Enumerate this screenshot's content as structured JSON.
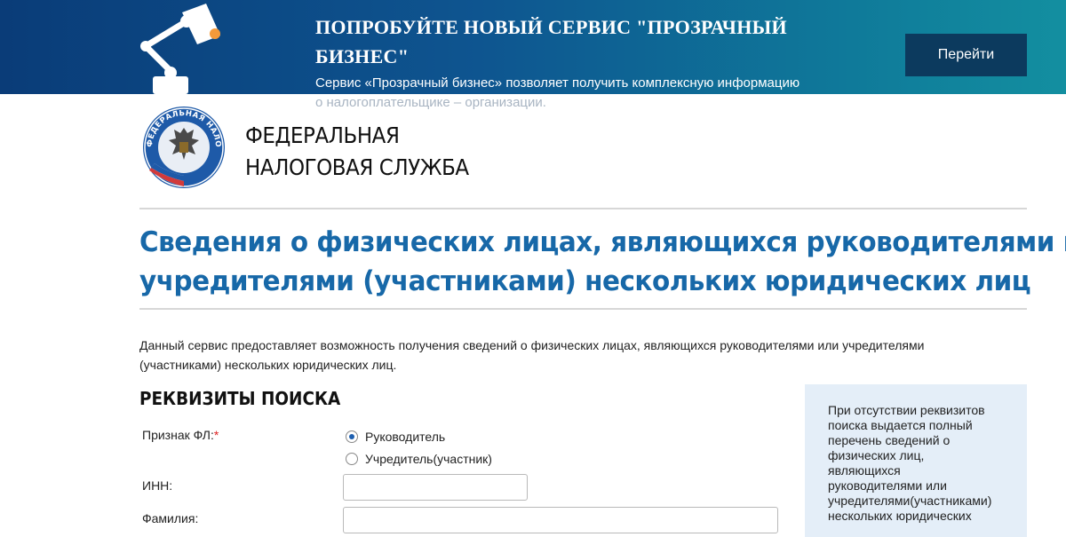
{
  "banner": {
    "title": "ПОПРОБУЙТЕ НОВЫЙ СЕРВИС \"ПРОЗРАЧНЫЙ БИЗНЕС\"",
    "description_line1": "Сервис «Прозрачный бизнес» позволяет получить комплексную информацию",
    "description_line2": "о налогоплательщике – организации.",
    "button_label": "Перейти",
    "icon": "desk-lamp-icon"
  },
  "header": {
    "emblem": "fns-emblem-icon",
    "emblem_text": "ФЕДЕРАЛЬНАЯ НАЛОГОВАЯ СЛУЖБА",
    "org_name_line1": "ФЕДЕРАЛЬНАЯ",
    "org_name_line2": "НАЛОГОВАЯ СЛУЖБА"
  },
  "page": {
    "title_line1": "Сведения о физических лицах, являющихся руководителями или",
    "title_line2": "учредителями (участниками) нескольких юридических лиц",
    "intro": "Данный сервис предоставляет возможность получения сведений о физических лицах, являющихся руководителями или учредителями (участниками) нескольких юридических лиц."
  },
  "form": {
    "heading": "РЕКВИЗИТЫ ПОИСКА",
    "sign_label": "Признак ФЛ:",
    "required_mark": "*",
    "radio_options": [
      {
        "label": "Руководитель",
        "checked": true
      },
      {
        "label": "Учредитель(участник)",
        "checked": false
      }
    ],
    "inn_label": "ИНН:",
    "inn_value": "",
    "surname_label": "Фамилия:",
    "surname_value": ""
  },
  "info_box": {
    "lines": [
      "При отсутствии реквизитов",
      "поиска выдается полный",
      "перечень сведений о",
      "физических лиц,",
      "являющихся",
      "руководителями или",
      "учредителями(участниками)",
      "нескольких юридических"
    ]
  },
  "colors": {
    "banner_dark": "#0a3c78",
    "banner_light": "#138fa0",
    "button_bg": "#0c3a5e",
    "title_blue": "#1768a8",
    "info_bg": "#e4eef8",
    "required": "#dd2222"
  }
}
